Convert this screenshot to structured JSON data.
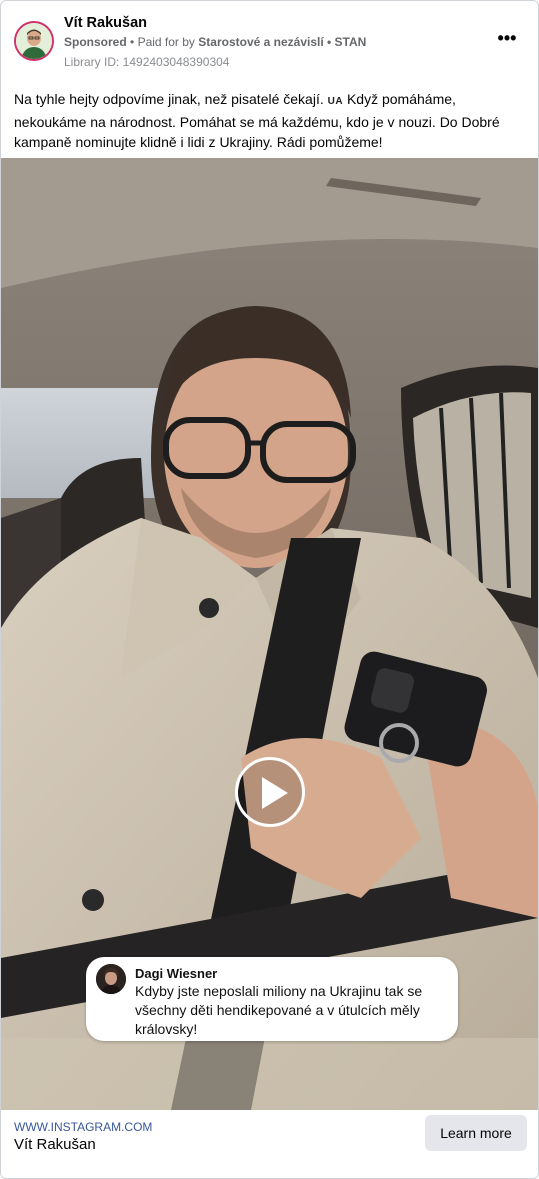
{
  "post": {
    "author": "Vít Rakušan",
    "sponsored_label": "Sponsored",
    "paid_for_prefix": "Paid for by",
    "paid_for_org": "Starostové a nezávislí • STAN",
    "separator": "•",
    "library_id": "Library ID: 1492403048390304",
    "more_icon": "•••",
    "text_part1": "Na tyhle hejty odpovíme jinak, než pisatelé čekají.",
    "ua_tag": "UA",
    "text_part2": "Když pomáháme, nekoukáme na národnost. Pomáhat se má každému, kdo je v nouzi. Do Dobré kampaně nominujte klidně i lidi z Ukrajiny. Rádi pomůžeme!"
  },
  "video": {
    "play_icon": "play-icon",
    "comment": {
      "name": "Dagi Wiesner",
      "text": "Kdyby jste neposlali miliony na Ukrajinu tak se všechny děti hendikepované a v útulcích měly královsky!"
    }
  },
  "footer": {
    "url": "WWW.INSTAGRAM.COM",
    "title": "Vít Rakušan",
    "cta": "Learn more"
  },
  "colors": {
    "link": "#385898",
    "avatar_ring": "#d0306a",
    "button_bg": "#e4e6eb"
  }
}
